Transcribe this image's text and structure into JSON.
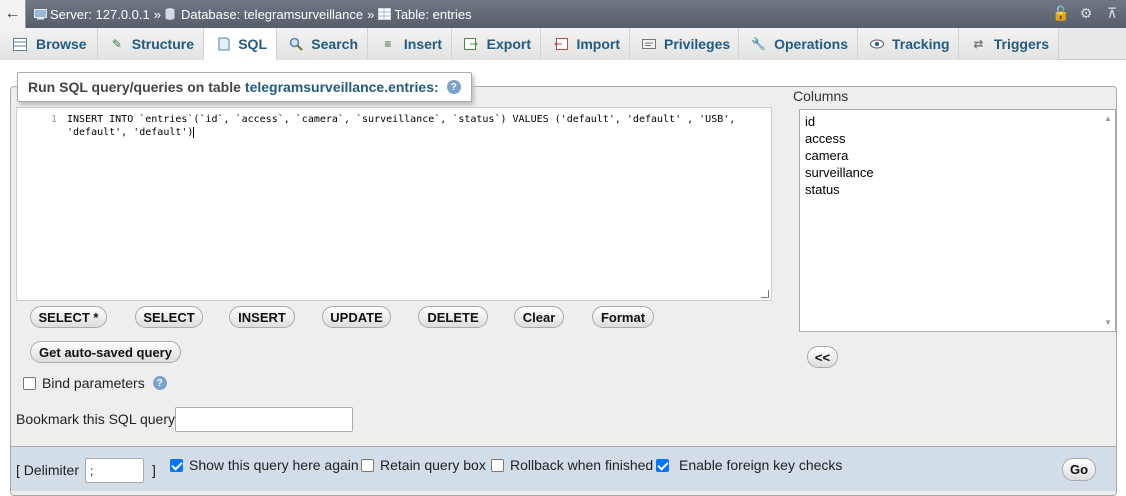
{
  "breadcrumb": {
    "server": "Server: 127.0.0.1",
    "database": "Database: telegramsurveillance",
    "table": "Table: entries",
    "separator": "»"
  },
  "tabs": [
    {
      "label": "Browse",
      "icon": "browse-icon"
    },
    {
      "label": "Structure",
      "icon": "structure-icon"
    },
    {
      "label": "SQL",
      "icon": "sql-icon",
      "active": true
    },
    {
      "label": "Search",
      "icon": "search-icon"
    },
    {
      "label": "Insert",
      "icon": "insert-icon"
    },
    {
      "label": "Export",
      "icon": "export-icon"
    },
    {
      "label": "Import",
      "icon": "import-icon"
    },
    {
      "label": "Privileges",
      "icon": "privileges-icon"
    },
    {
      "label": "Operations",
      "icon": "wrench-icon"
    },
    {
      "label": "Tracking",
      "icon": "eye-icon"
    },
    {
      "label": "Triggers",
      "icon": "triggers-icon"
    }
  ],
  "legend": {
    "prefix": "Run SQL query/queries on table",
    "table": "telegramsurveillance.entries:"
  },
  "editor": {
    "line_number": "1",
    "code_line1": "INSERT INTO `entries`(`id`, `access`, `camera`, `surveillance`, `status`) VALUES ('default', 'default' , 'USB',",
    "code_line2": "'default', 'default')"
  },
  "buttons": {
    "select_star": "SELECT *",
    "select": "SELECT",
    "insert": "INSERT",
    "update": "UPDATE",
    "delete": "DELETE",
    "clear": "Clear",
    "format": "Format",
    "get_autosaved": "Get auto-saved query",
    "insert_column": "<<",
    "go": "Go"
  },
  "columns": {
    "label": "Columns",
    "items": [
      "id",
      "access",
      "camera",
      "surveillance",
      "status"
    ]
  },
  "bind_parameters": {
    "label": "Bind parameters",
    "checked": false
  },
  "bookmark": {
    "label": "Bookmark this SQL query:",
    "value": ""
  },
  "footer": {
    "delimiter_label": "[ Delimiter",
    "delimiter_value": ";",
    "delimiter_close": "]",
    "show_query": {
      "label": "Show this query here again",
      "checked": true
    },
    "retain_box": {
      "label": "Retain query box",
      "checked": false
    },
    "rollback": {
      "label": "Rollback when finished",
      "checked": false
    },
    "foreign_keys": {
      "label": "Enable foreign key checks",
      "checked": true
    }
  },
  "colors": {
    "accent": "#235a81",
    "checkbox": "#0075ff",
    "footer_bg": "#d2dde7"
  }
}
